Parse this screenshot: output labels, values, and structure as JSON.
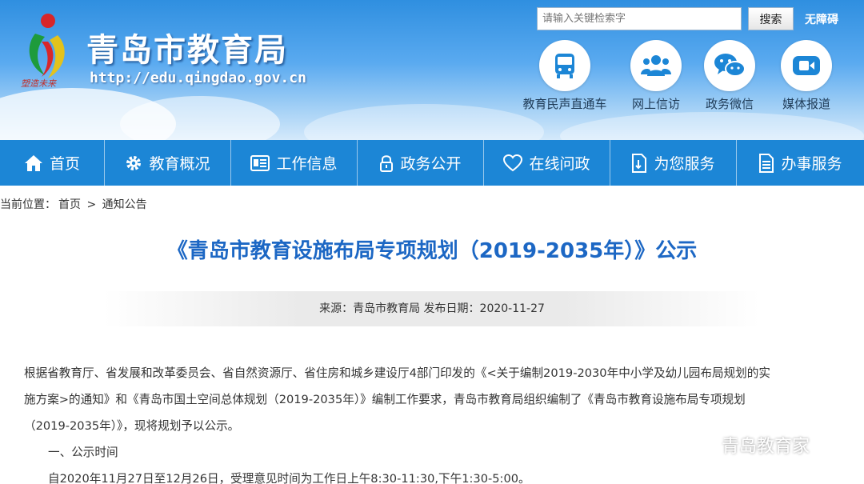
{
  "site": {
    "title": "青岛市教育局",
    "url": "http://edu.qingdao.gov.cn",
    "slogan": "塑造未来"
  },
  "search": {
    "placeholder": "请输入关键检索字",
    "button_label": "搜索",
    "accessibility_label": "无障碍"
  },
  "quick_links": [
    {
      "label": "教育民声直通车",
      "icon": "bus-icon"
    },
    {
      "label": "网上信访",
      "icon": "people-icon"
    },
    {
      "label": "政务微信",
      "icon": "wechat-icon"
    },
    {
      "label": "媒体报道",
      "icon": "video-camera-icon"
    }
  ],
  "nav": {
    "items": [
      {
        "label": "首页",
        "icon": "home-icon"
      },
      {
        "label": "教育概况",
        "icon": "gear-icon"
      },
      {
        "label": "工作信息",
        "icon": "news-icon"
      },
      {
        "label": "政务公开",
        "icon": "lock-icon"
      },
      {
        "label": "在线问政",
        "icon": "heart-icon"
      },
      {
        "label": "为您服务",
        "icon": "document-icon"
      },
      {
        "label": "办事服务",
        "icon": "list-icon"
      }
    ]
  },
  "breadcrumb": {
    "prefix": "当前位置：",
    "home": "首页",
    "separator": ">",
    "current": "通知公告"
  },
  "article": {
    "title": "《青岛市教育设施布局专项规划（2019-2035年）》公示",
    "meta": "来源：青岛市教育局 发布日期：2020-11-27",
    "paragraphs": [
      "根据省教育厅、省发展和改革委员会、省自然资源厅、省住房和城乡建设厅4部门印发的《<关于编制2019-2030年中小学及幼儿园布局规划的实",
      "施方案>的通知》和《青岛市国土空间总体规划（2019-2035年）》编制工作要求，青岛市教育局组织编制了《青岛市教育设施布局专项规划",
      "（2019-2035年）》，现将规划予以公示。"
    ],
    "section_heading": "一、公示时间",
    "section_text": "自2020年11月27日至12月26日，受理意见时间为工作日上午8:30-11:30,下午1:30-5:00。"
  },
  "watermark": {
    "text": "青岛教育家",
    "icon": "wechat-icon"
  },
  "colors": {
    "nav_blue": "#1c86d6",
    "title_blue": "#1c67c4",
    "header_sky": "#2f8fe0"
  }
}
